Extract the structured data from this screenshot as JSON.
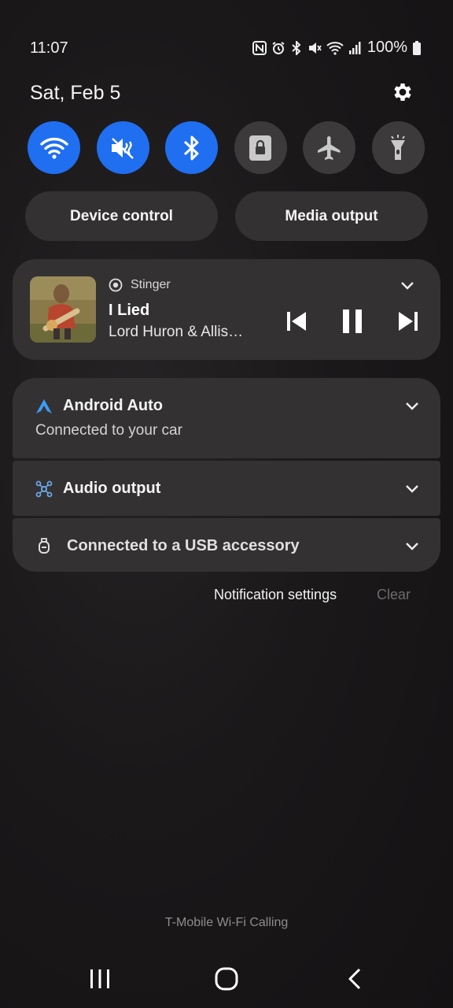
{
  "status_bar": {
    "time": "11:07",
    "battery": "100%",
    "icons": [
      "nfc-icon",
      "alarm-icon",
      "bluetooth-icon",
      "mute-icon",
      "wifi-icon",
      "signal-icon",
      "battery-icon"
    ]
  },
  "header": {
    "date": "Sat, Feb 5",
    "settings_icon": "gear-icon"
  },
  "quick_tiles": [
    {
      "name": "wifi",
      "icon": "wifi-icon",
      "active": true
    },
    {
      "name": "mute",
      "icon": "mute-icon",
      "active": true
    },
    {
      "name": "bluetooth",
      "icon": "bluetooth-icon",
      "active": true
    },
    {
      "name": "screen-lock",
      "icon": "lock-rotation-icon",
      "active": false
    },
    {
      "name": "airplane-mode",
      "icon": "airplane-icon",
      "active": false
    },
    {
      "name": "flashlight",
      "icon": "flashlight-icon",
      "active": false
    }
  ],
  "pills": {
    "device_control": "Device control",
    "media_output": "Media output"
  },
  "media": {
    "app": "Stinger",
    "title": "I Lied",
    "artist": "Lord Huron & Allis…",
    "state": "playing"
  },
  "notifications": [
    {
      "icon": "android-auto-icon",
      "title": "Android Auto",
      "subtitle": "Connected to your car"
    },
    {
      "icon": "audio-output-icon",
      "title": "Audio output"
    },
    {
      "icon": "usb-icon",
      "title": "Connected to a USB accessory"
    }
  ],
  "footer": {
    "notification_settings": "Notification settings",
    "clear": "Clear",
    "wifi_calling": "T-Mobile Wi-Fi Calling"
  },
  "colors": {
    "accent": "#1f6ff0",
    "tile_off": "#3c3a3b",
    "card": "#333132",
    "android_auto": "#3d9cf5"
  }
}
